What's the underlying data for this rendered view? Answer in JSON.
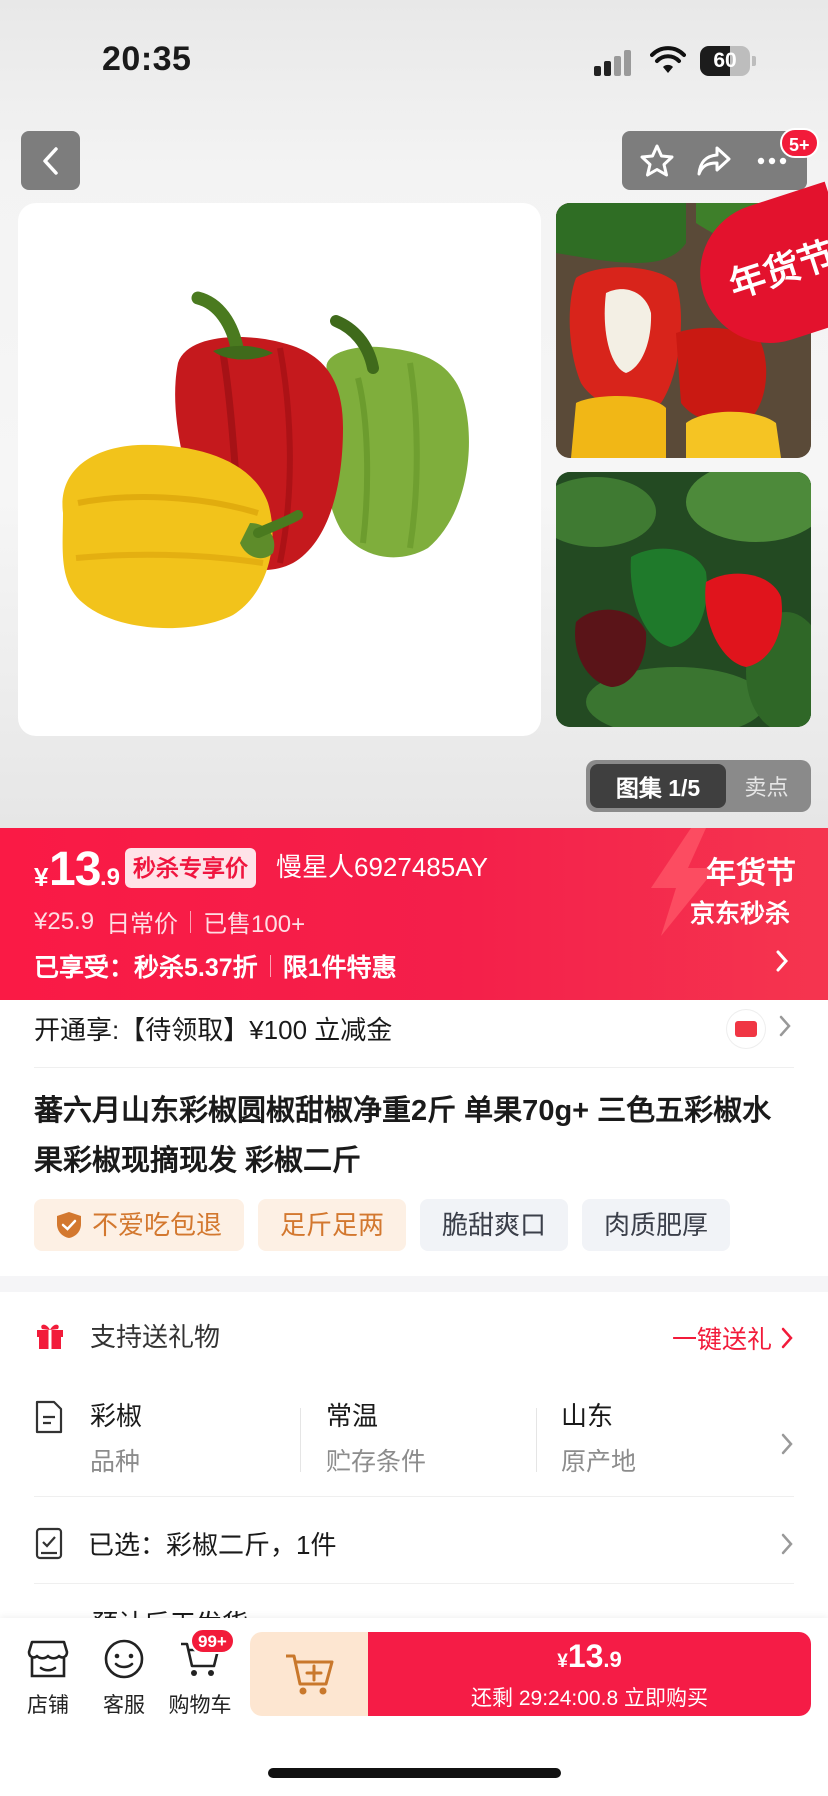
{
  "status_bar": {
    "time": "20:35",
    "battery": "60"
  },
  "header": {
    "notification_badge": "5+"
  },
  "gallery": {
    "active_label": "图集 1/5",
    "inactive_label": "卖点",
    "festival_tag": "年货节"
  },
  "price_band": {
    "currency": "¥",
    "price_int": "13",
    "price_dec": ".9",
    "badge": "秒杀专享价",
    "user_label": "慢星人6927485AY",
    "original_price": "¥25.9",
    "original_label": "日常价",
    "sold": "已售100+",
    "benefit_prefix": "已享受：",
    "benefit_discount": "秒杀5.37折",
    "benefit_limit": "限1件特惠",
    "festival": "年货节",
    "jd_flash": "京东秒杀"
  },
  "coupon": {
    "text": "开通享:【待领取】¥100 立减金"
  },
  "product": {
    "title": "蕃六月山东彩椒圆椒甜椒净重2斤 单果70g+ 三色五彩椒水果彩椒现摘现发 彩椒二斤",
    "tags": [
      "不爱吃包退",
      "足斤足两",
      "脆甜爽口",
      "肉质肥厚"
    ]
  },
  "gift": {
    "label": "支持送礼物",
    "action": "一键送礼"
  },
  "specs": [
    {
      "value": "彩椒",
      "key": "品种"
    },
    {
      "value": "常温",
      "key": "贮存条件"
    },
    {
      "value": "山东",
      "key": "原产地"
    }
  ],
  "selection": {
    "text": "已选：彩椒二斤，1件"
  },
  "shipping_partial": {
    "text": "预计后天发货"
  },
  "bottom_bar": {
    "store": "店铺",
    "service": "客服",
    "cart": "购物车",
    "cart_badge": "99+",
    "buy_currency": "¥",
    "buy_int": "13",
    "buy_dec": ".9",
    "buy_sub": "还剩 29:24:00.8 立即购买"
  },
  "colors": {
    "accent": "#f51c46",
    "warm_tag_bg": "#fdf0e4",
    "warm_tag_text": "#d3782f"
  }
}
